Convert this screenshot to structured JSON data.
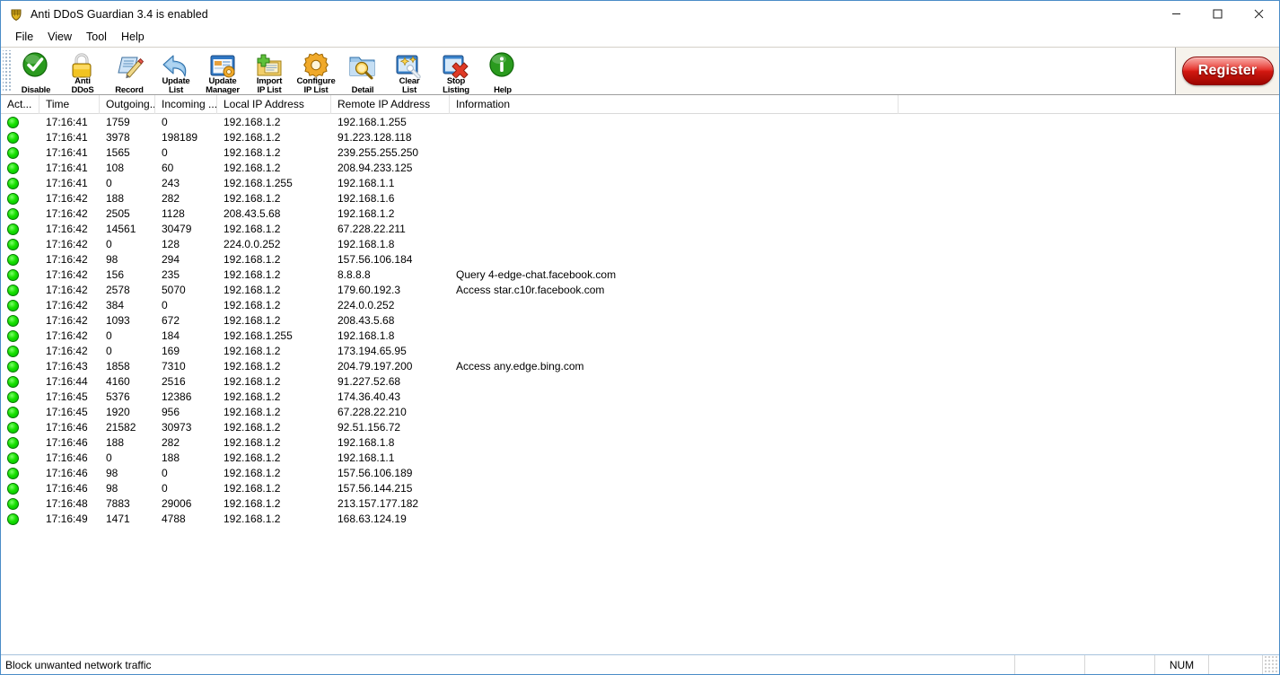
{
  "window": {
    "title": "Anti DDoS Guardian 3.4 is enabled",
    "app_icon": "shield-icon",
    "controls": {
      "minimize": "─",
      "maximize": "□",
      "close": "✕"
    }
  },
  "menubar": {
    "items": [
      {
        "label": "File"
      },
      {
        "label": "View"
      },
      {
        "label": "Tool"
      },
      {
        "label": "Help"
      }
    ]
  },
  "toolbar": {
    "buttons": [
      {
        "label": "Disable",
        "icon": "green-check-circle-icon"
      },
      {
        "label": "Anti\nDDoS",
        "icon": "yellow-padlock-icon"
      },
      {
        "label": "Record",
        "icon": "document-pencil-icon"
      },
      {
        "label": "Update\nList",
        "icon": "blue-back-arrow-icon"
      },
      {
        "label": "Update\nManager",
        "icon": "blue-window-gear-icon"
      },
      {
        "label": "Import\nIP List",
        "icon": "folder-plus-icon"
      },
      {
        "label": "Configure\nIP List",
        "icon": "orange-gear-icon"
      },
      {
        "label": "Detail",
        "icon": "folder-magnifier-icon"
      },
      {
        "label": "Clear\nList",
        "icon": "magic-wand-icon"
      },
      {
        "label": "Stop\nListing",
        "icon": "red-x-window-icon"
      },
      {
        "label": "Help",
        "icon": "green-info-circle-icon"
      }
    ],
    "register_label": "Register"
  },
  "listview": {
    "columns": [
      {
        "key": "act",
        "label": "Act..."
      },
      {
        "key": "time",
        "label": "Time"
      },
      {
        "key": "out",
        "label": "Outgoing..."
      },
      {
        "key": "in",
        "label": "Incoming ..."
      },
      {
        "key": "lip",
        "label": "Local IP Address"
      },
      {
        "key": "rip",
        "label": "Remote IP Address"
      },
      {
        "key": "info",
        "label": "Information"
      }
    ],
    "rows": [
      {
        "status": "active",
        "time": "17:16:41",
        "out": "1759",
        "in": "0",
        "lip": "192.168.1.2",
        "rip": "192.168.1.255",
        "info": ""
      },
      {
        "status": "active",
        "time": "17:16:41",
        "out": "3978",
        "in": "198189",
        "lip": "192.168.1.2",
        "rip": "91.223.128.118",
        "info": ""
      },
      {
        "status": "active",
        "time": "17:16:41",
        "out": "1565",
        "in": "0",
        "lip": "192.168.1.2",
        "rip": "239.255.255.250",
        "info": ""
      },
      {
        "status": "active",
        "time": "17:16:41",
        "out": "108",
        "in": "60",
        "lip": "192.168.1.2",
        "rip": "208.94.233.125",
        "info": ""
      },
      {
        "status": "active",
        "time": "17:16:41",
        "out": "0",
        "in": "243",
        "lip": "192.168.1.255",
        "rip": "192.168.1.1",
        "info": ""
      },
      {
        "status": "active",
        "time": "17:16:42",
        "out": "188",
        "in": "282",
        "lip": "192.168.1.2",
        "rip": "192.168.1.6",
        "info": ""
      },
      {
        "status": "active",
        "time": "17:16:42",
        "out": "2505",
        "in": "1128",
        "lip": "208.43.5.68",
        "rip": "192.168.1.2",
        "info": ""
      },
      {
        "status": "active",
        "time": "17:16:42",
        "out": "14561",
        "in": "30479",
        "lip": "192.168.1.2",
        "rip": "67.228.22.211",
        "info": ""
      },
      {
        "status": "active",
        "time": "17:16:42",
        "out": "0",
        "in": "128",
        "lip": "224.0.0.252",
        "rip": "192.168.1.8",
        "info": ""
      },
      {
        "status": "active",
        "time": "17:16:42",
        "out": "98",
        "in": "294",
        "lip": "192.168.1.2",
        "rip": "157.56.106.184",
        "info": ""
      },
      {
        "status": "active",
        "time": "17:16:42",
        "out": "156",
        "in": "235",
        "lip": "192.168.1.2",
        "rip": "8.8.8.8",
        "info": "Query 4-edge-chat.facebook.com"
      },
      {
        "status": "active",
        "time": "17:16:42",
        "out": "2578",
        "in": "5070",
        "lip": "192.168.1.2",
        "rip": "179.60.192.3",
        "info": "Access star.c10r.facebook.com"
      },
      {
        "status": "active",
        "time": "17:16:42",
        "out": "384",
        "in": "0",
        "lip": "192.168.1.2",
        "rip": "224.0.0.252",
        "info": ""
      },
      {
        "status": "active",
        "time": "17:16:42",
        "out": "1093",
        "in": "672",
        "lip": "192.168.1.2",
        "rip": "208.43.5.68",
        "info": ""
      },
      {
        "status": "active",
        "time": "17:16:42",
        "out": "0",
        "in": "184",
        "lip": "192.168.1.255",
        "rip": "192.168.1.8",
        "info": ""
      },
      {
        "status": "active",
        "time": "17:16:42",
        "out": "0",
        "in": "169",
        "lip": "192.168.1.2",
        "rip": "173.194.65.95",
        "info": ""
      },
      {
        "status": "active",
        "time": "17:16:43",
        "out": "1858",
        "in": "7310",
        "lip": "192.168.1.2",
        "rip": "204.79.197.200",
        "info": "Access any.edge.bing.com"
      },
      {
        "status": "active",
        "time": "17:16:44",
        "out": "4160",
        "in": "2516",
        "lip": "192.168.1.2",
        "rip": "91.227.52.68",
        "info": ""
      },
      {
        "status": "active",
        "time": "17:16:45",
        "out": "5376",
        "in": "12386",
        "lip": "192.168.1.2",
        "rip": "174.36.40.43",
        "info": ""
      },
      {
        "status": "active",
        "time": "17:16:45",
        "out": "1920",
        "in": "956",
        "lip": "192.168.1.2",
        "rip": "67.228.22.210",
        "info": ""
      },
      {
        "status": "active",
        "time": "17:16:46",
        "out": "21582",
        "in": "30973",
        "lip": "192.168.1.2",
        "rip": "92.51.156.72",
        "info": ""
      },
      {
        "status": "active",
        "time": "17:16:46",
        "out": "188",
        "in": "282",
        "lip": "192.168.1.2",
        "rip": "192.168.1.8",
        "info": ""
      },
      {
        "status": "active",
        "time": "17:16:46",
        "out": "0",
        "in": "188",
        "lip": "192.168.1.2",
        "rip": "192.168.1.1",
        "info": ""
      },
      {
        "status": "active",
        "time": "17:16:46",
        "out": "98",
        "in": "0",
        "lip": "192.168.1.2",
        "rip": "157.56.106.189",
        "info": ""
      },
      {
        "status": "active",
        "time": "17:16:46",
        "out": "98",
        "in": "0",
        "lip": "192.168.1.2",
        "rip": "157.56.144.215",
        "info": ""
      },
      {
        "status": "active",
        "time": "17:16:48",
        "out": "7883",
        "in": "29006",
        "lip": "192.168.1.2",
        "rip": "213.157.177.182",
        "info": ""
      },
      {
        "status": "active",
        "time": "17:16:49",
        "out": "1471",
        "in": "4788",
        "lip": "192.168.1.2",
        "rip": "168.63.124.19",
        "info": ""
      }
    ]
  },
  "statusbar": {
    "message": "Block unwanted network traffic",
    "pane1": "",
    "pane2": "",
    "num_indicator": "NUM",
    "pane3": ""
  },
  "colors": {
    "accent": "#4a8cc7",
    "status_active": "#17e000",
    "register_red": "#e01a12",
    "toolbar_bg": "#ffffff"
  }
}
